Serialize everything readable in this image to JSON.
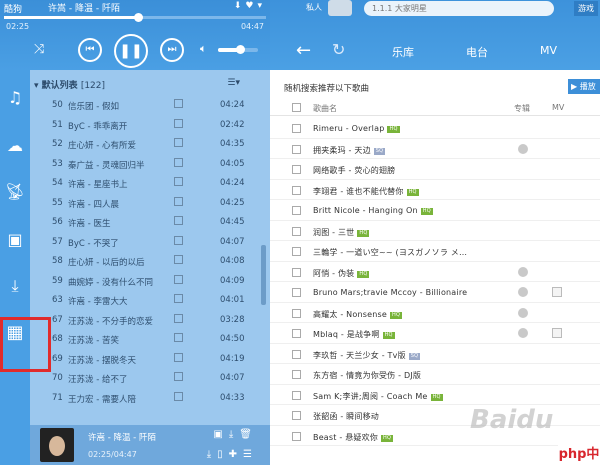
{
  "player": {
    "brand": "酷狗",
    "current_song": "许嵩 - 降温 - 阡陌",
    "time_current": "02:25",
    "time_total": "04:47",
    "progress_fraction": 0.51,
    "volume_fraction": 0.55
  },
  "playlist": {
    "title": "默认列表",
    "count": "[122]",
    "rows": [
      {
        "num": "50",
        "title": "信乐团 - 假如",
        "dur": "04:24"
      },
      {
        "num": "51",
        "title": "ByC - 乖乖离开",
        "dur": "02:42"
      },
      {
        "num": "52",
        "title": "庄心妍 - 心有所爱",
        "dur": "04:35"
      },
      {
        "num": "53",
        "title": "秦广益 - 灵魂回归半",
        "dur": "04:05"
      },
      {
        "num": "54",
        "title": "许嵩 - 星座书上",
        "dur": "04:24"
      },
      {
        "num": "55",
        "title": "许嵩 - 四人晨",
        "dur": "04:25"
      },
      {
        "num": "56",
        "title": "许嵩 - 医生",
        "dur": "04:45"
      },
      {
        "num": "57",
        "title": "ByC - 不哭了",
        "dur": "04:07"
      },
      {
        "num": "58",
        "title": "庄心妍 - 以后的以后",
        "dur": "04:08"
      },
      {
        "num": "59",
        "title": "曲婉婷 - 没有什么不同",
        "dur": "04:09"
      },
      {
        "num": "63",
        "title": "许嵩 - 李雷大大",
        "dur": "04:01"
      },
      {
        "num": "67",
        "title": "汪苏泷 - 不分手的恋爱",
        "dur": "03:28"
      },
      {
        "num": "68",
        "title": "汪苏泷 - 苦笑",
        "dur": "04:50"
      },
      {
        "num": "69",
        "title": "汪苏泷 - 摆脱冬天",
        "dur": "04:19"
      },
      {
        "num": "70",
        "title": "汪苏泷 - 给不了",
        "dur": "04:07"
      },
      {
        "num": "71",
        "title": "王力宏 - 需要人陪",
        "dur": "04:33"
      }
    ]
  },
  "now_playing": {
    "title": "许嵩 - 降温 - 阡陌",
    "time": "02:25/04:47"
  },
  "right": {
    "user_label": "私人",
    "search_placeholder": "1.1.1 大家明星",
    "game_label": "游戏",
    "tabs": [
      "乐库",
      "电台",
      "MV"
    ],
    "rec_title": "随机搜索推荐以下歌曲",
    "rec_button": "播放",
    "columns": {
      "name": "歌曲名",
      "col2": "专辑",
      "col3": "MV"
    },
    "songs": [
      {
        "title": "Rimeru - Overlap",
        "badge": "HQ",
        "circ": false,
        "film": false
      },
      {
        "title": "拥夹柔玛 - 天边",
        "badge": "SQ",
        "circ": true,
        "film": false
      },
      {
        "title": "网络歌手 - 荧心的翅膀",
        "badge": "",
        "circ": false,
        "film": false
      },
      {
        "title": "李翊君 - 谁也不能代替你",
        "badge": "HQ",
        "circ": false,
        "film": false
      },
      {
        "title": "Britt Nicole - Hanging On",
        "badge": "HQ",
        "circ": false,
        "film": false
      },
      {
        "title": "润图 - 三世",
        "badge": "HQ",
        "circ": false,
        "film": false
      },
      {
        "title": "三輪学 - 一道い空~~ (ヨスガノソラ メ…",
        "badge": "",
        "circ": false,
        "film": false
      },
      {
        "title": "阿悄 - 伪装",
        "badge": "HQ",
        "circ": true,
        "film": false
      },
      {
        "title": "Bruno Mars;travie Mccoy - Billionaire",
        "badge": "",
        "circ": true,
        "film": true
      },
      {
        "title": "高耀太 - Nonsense",
        "badge": "HQ",
        "circ": true,
        "film": false
      },
      {
        "title": "Mblaq - 是战争啊",
        "badge": "HQ",
        "circ": true,
        "film": true
      },
      {
        "title": "李玖哲 - 天兰少女 - Tv版",
        "badge": "SQ",
        "circ": false,
        "film": false
      },
      {
        "title": "东方宿 - 情竟为你受伤 - DJ版",
        "badge": "",
        "circ": false,
        "film": false
      },
      {
        "title": "Sam K;李讲;周阅 - Coach Me",
        "badge": "HQ",
        "circ": false,
        "film": false
      },
      {
        "title": "张韶函 - 瞬间移动",
        "badge": "",
        "circ": false,
        "film": false
      },
      {
        "title": "Beast - 悬疑欢你",
        "badge": "HQ",
        "circ": false,
        "film": false
      }
    ]
  },
  "watermark": {
    "text": "Baidu",
    "site": "php中文网"
  }
}
